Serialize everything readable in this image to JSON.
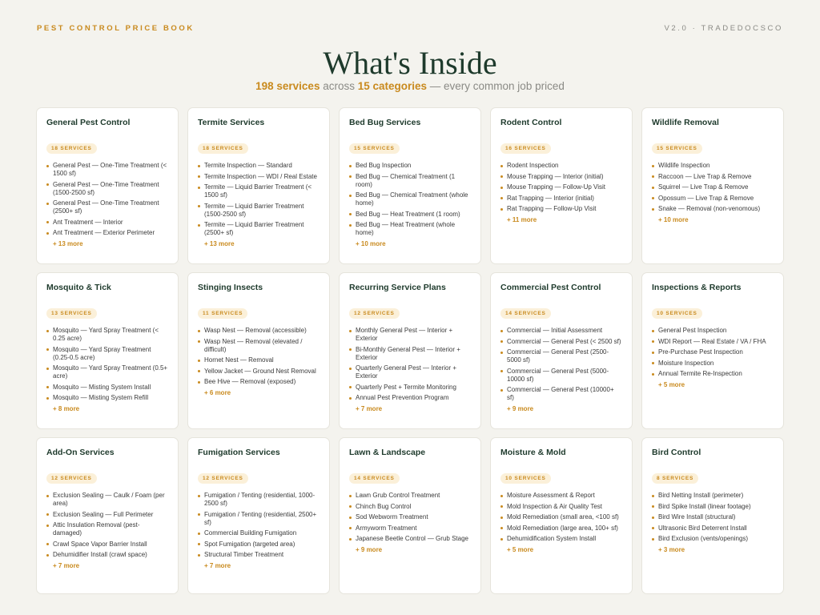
{
  "header": {
    "brand": "PEST CONTROL PRICE BOOK",
    "version": "V2.0 · TRADEDOCSCO",
    "title": "What's Inside",
    "subtitle_services": "198 services",
    "subtitle_across": " across ",
    "subtitle_categories": "15 categories",
    "subtitle_tail": " — every common job priced"
  },
  "categories": [
    {
      "title": "General Pest Control",
      "badge": "18 SERVICES",
      "items": [
        "General Pest — One-Time Treatment (< 1500 sf)",
        "General Pest — One-Time Treatment (1500-2500 sf)",
        "General Pest — One-Time Treatment (2500+ sf)",
        "Ant Treatment — Interior",
        "Ant Treatment — Exterior Perimeter"
      ],
      "more": "+ 13 more"
    },
    {
      "title": "Termite Services",
      "badge": "18 SERVICES",
      "items": [
        "Termite Inspection — Standard",
        "Termite Inspection — WDI / Real Estate",
        "Termite — Liquid Barrier Treatment (< 1500 sf)",
        "Termite — Liquid Barrier Treatment (1500-2500 sf)",
        "Termite — Liquid Barrier Treatment (2500+ sf)"
      ],
      "more": "+ 13 more"
    },
    {
      "title": "Bed Bug Services",
      "badge": "15 SERVICES",
      "items": [
        "Bed Bug Inspection",
        "Bed Bug — Chemical Treatment (1 room)",
        "Bed Bug — Chemical Treatment (whole home)",
        "Bed Bug — Heat Treatment (1 room)",
        "Bed Bug — Heat Treatment (whole home)"
      ],
      "more": "+ 10 more"
    },
    {
      "title": "Rodent Control",
      "badge": "16 SERVICES",
      "items": [
        "Rodent Inspection",
        "Mouse Trapping — Interior (initial)",
        "Mouse Trapping — Follow-Up Visit",
        "Rat Trapping — Interior (initial)",
        "Rat Trapping — Follow-Up Visit"
      ],
      "more": "+ 11 more"
    },
    {
      "title": "Wildlife Removal",
      "badge": "15 SERVICES",
      "items": [
        "Wildlife Inspection",
        "Raccoon — Live Trap & Remove",
        "Squirrel — Live Trap & Remove",
        "Opossum — Live Trap & Remove",
        "Snake — Removal (non-venomous)"
      ],
      "more": "+ 10 more"
    },
    {
      "title": "Mosquito & Tick",
      "badge": "13 SERVICES",
      "items": [
        "Mosquito — Yard Spray Treatment (< 0.25 acre)",
        "Mosquito — Yard Spray Treatment (0.25-0.5 acre)",
        "Mosquito — Yard Spray Treatment (0.5+ acre)",
        "Mosquito — Misting System Install",
        "Mosquito — Misting System Refill"
      ],
      "more": "+ 8 more"
    },
    {
      "title": "Stinging Insects",
      "badge": "11 SERVICES",
      "items": [
        "Wasp Nest — Removal (accessible)",
        "Wasp Nest — Removal (elevated / difficult)",
        "Hornet Nest — Removal",
        "Yellow Jacket — Ground Nest Removal",
        "Bee Hive — Removal (exposed)"
      ],
      "more": "+ 6 more"
    },
    {
      "title": "Recurring Service Plans",
      "badge": "12 SERVICES",
      "items": [
        "Monthly General Pest — Interior + Exterior",
        "Bi-Monthly General Pest — Interior + Exterior",
        "Quarterly General Pest — Interior + Exterior",
        "Quarterly Pest + Termite Monitoring",
        "Annual Pest Prevention Program"
      ],
      "more": "+ 7 more"
    },
    {
      "title": "Commercial Pest Control",
      "badge": "14 SERVICES",
      "items": [
        "Commercial — Initial Assessment",
        "Commercial — General Pest (< 2500 sf)",
        "Commercial — General Pest (2500-5000 sf)",
        "Commercial — General Pest (5000-10000 sf)",
        "Commercial — General Pest (10000+ sf)"
      ],
      "more": "+ 9 more"
    },
    {
      "title": "Inspections & Reports",
      "badge": "10 SERVICES",
      "items": [
        "General Pest Inspection",
        "WDI Report — Real Estate / VA / FHA",
        "Pre-Purchase Pest Inspection",
        "Moisture Inspection",
        "Annual Termite Re-Inspection"
      ],
      "more": "+ 5 more"
    },
    {
      "title": "Add-On Services",
      "badge": "12 SERVICES",
      "items": [
        "Exclusion Sealing — Caulk / Foam (per area)",
        "Exclusion Sealing — Full Perimeter",
        "Attic Insulation Removal (pest-damaged)",
        "Crawl Space Vapor Barrier Install",
        "Dehumidifier Install (crawl space)"
      ],
      "more": "+ 7 more"
    },
    {
      "title": "Fumigation Services",
      "badge": "12 SERVICES",
      "items": [
        "Fumigation / Tenting (residential, 1000-2500 sf)",
        "Fumigation / Tenting (residential, 2500+ sf)",
        "Commercial Building Fumigation",
        "Spot Fumigation (targeted area)",
        "Structural Timber Treatment"
      ],
      "more": "+ 7 more"
    },
    {
      "title": "Lawn & Landscape",
      "badge": "14 SERVICES",
      "items": [
        "Lawn Grub Control Treatment",
        "Chinch Bug Control",
        "Sod Webworm Treatment",
        "Armyworm Treatment",
        "Japanese Beetle Control — Grub Stage"
      ],
      "more": "+ 9 more"
    },
    {
      "title": "Moisture & Mold",
      "badge": "10 SERVICES",
      "items": [
        "Moisture Assessment & Report",
        "Mold Inspection & Air Quality Test",
        "Mold Remediation (small area, <100 sf)",
        "Mold Remediation (large area, 100+ sf)",
        "Dehumidification System Install"
      ],
      "more": "+ 5 more"
    },
    {
      "title": "Bird Control",
      "badge": "8 SERVICES",
      "items": [
        "Bird Netting Install (perimeter)",
        "Bird Spike Install (linear footage)",
        "Bird Wire Install (structural)",
        "Ultrasonic Bird Deterrent Install",
        "Bird Exclusion (vents/openings)"
      ],
      "more": "+ 3 more"
    }
  ]
}
